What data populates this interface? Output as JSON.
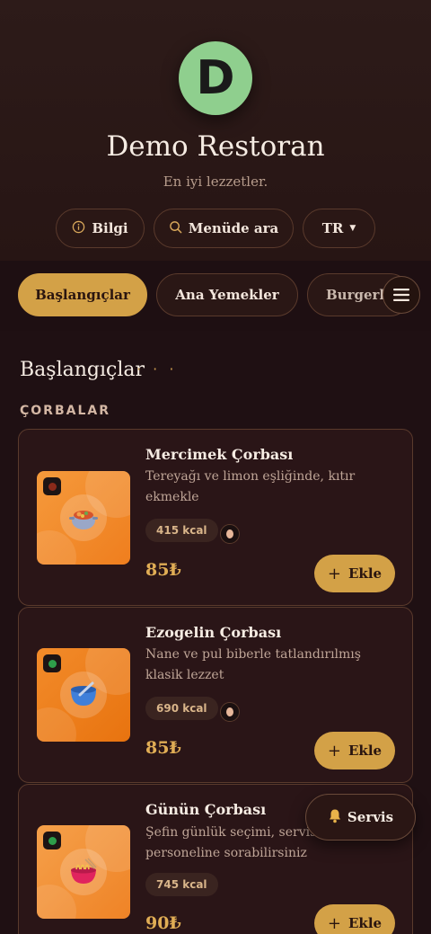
{
  "restaurant": {
    "logo_letter": "D",
    "name": "Demo Restoran",
    "tagline": "En iyi lezzetler."
  },
  "header_buttons": {
    "info": {
      "icon": "info-circle-icon",
      "label": "Bilgi"
    },
    "search": {
      "icon": "search-icon",
      "label": "Menüde ara"
    },
    "language": {
      "label": "TR",
      "icon": "caret-down-icon"
    }
  },
  "tabs": [
    {
      "label": "Başlangıçlar",
      "active": true
    },
    {
      "label": "Ana Yemekler",
      "active": false
    },
    {
      "label": "Burgerler",
      "active": false
    }
  ],
  "menu_icon": "hamburger-menu-icon",
  "section": {
    "title": "Başlangıçlar",
    "decoration": "· · ·",
    "category": "ÇORBALAR"
  },
  "items": [
    {
      "name": "Mercimek Çorbası",
      "description": "Tereyağı ve limon eşliğinde, kıtır ekmekle",
      "kcal": "415 kcal",
      "price": "85₺",
      "add_label": "Ekle",
      "dietary": "non-veg",
      "dietary_color": "#8a2a1a",
      "thumb_color": "#f08a2c",
      "thumb_icon": "pot-icon",
      "allergen_icon": "egg-icon"
    },
    {
      "name": "Ezogelin Çorbası",
      "description": "Nane ve pul biberle tatlandırılmış klasik lezzet",
      "kcal": "690 kcal",
      "price": "85₺",
      "add_label": "Ekle",
      "dietary": "veg",
      "dietary_color": "#2e9e4a",
      "thumb_color": "#ee7f1c",
      "thumb_icon": "bowl-icon",
      "allergen_icon": "egg-icon"
    },
    {
      "name": "Günün Çorbası",
      "description": "Şefin günlük seçimi, servis personeline sorabilirsiniz",
      "kcal": "745 kcal",
      "price": "90₺",
      "add_label": "Ekle",
      "dietary": "veg",
      "dietary_color": "#2e9e4a",
      "thumb_color": "#f08a2c",
      "thumb_icon": "noodle-bowl-icon"
    }
  ],
  "service_button": {
    "icon": "bell-icon",
    "label": "Servis"
  }
}
